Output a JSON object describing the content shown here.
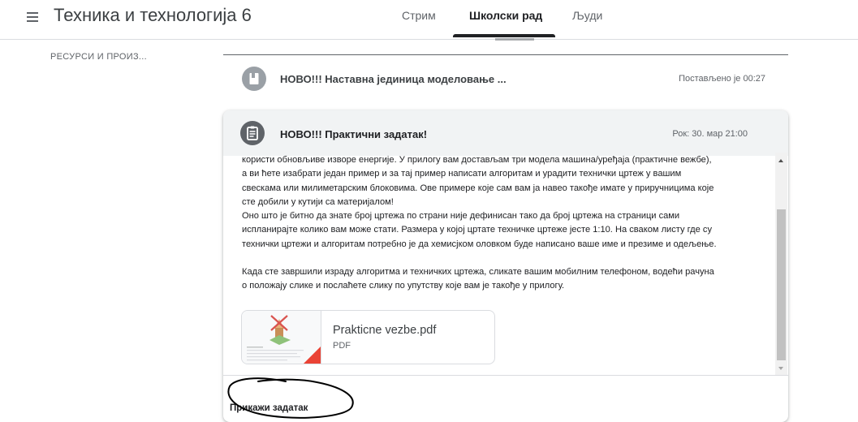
{
  "header": {
    "class_title": "Техника и технологија 6",
    "tabs": [
      {
        "label": "Стрим",
        "active": false
      },
      {
        "label": "Школски рад",
        "active": true
      },
      {
        "label": "Људи",
        "active": false
      }
    ]
  },
  "sidebar": {
    "topic_label": "РЕСУРСИ И ПРОИЗ..."
  },
  "material_item": {
    "icon": "bookmark-icon",
    "title": "НОВО!!! Наставна јединица моделовање ...",
    "meta": "Постављено је 00:27"
  },
  "assignment": {
    "icon": "assignment-icon",
    "title": "НОВО!!! Практични задатак!",
    "due": "Рок: 30. мар 21:00",
    "description": [
      "користи обновљиве изворе енергије. У прилогу вам достављам три модела машина/уређаја (практичне вежбе),",
      "а ви ћете изабрати један пример и за тај пример написати алгоритам и урадити технички цртеж у вашим",
      "свескама или милиметарским блоковима. Ове примере које сам вам ја навео такође имате у приручницима које",
      "сте добили у кутији са материјалом!",
      "Оно што је битно да знате број цртежа по страни није дефинисан тако да број цртежа на страници сами",
      "испланирајте колико вам може стати. Размера у којој цртате техничке цртеже јесте 1:10. На сваком листу где су",
      "технички цртежи и алгоритам потребно је да хемисјком оловком буде написано ваше име и презиме и одељење.",
      "",
      "Када сте завршили израду алгоритма и техничких цртежа, сликате вашим мобилним телефоном, водећи рачуна",
      "о положају слике и послаћете слику по упутству које вам је такође у прилогу."
    ],
    "attachment": {
      "name": "Prakticne vezbe.pdf",
      "type": "PDF",
      "icon": "pdf-thumbnail"
    },
    "view_label": "Прикажи задатак"
  },
  "colors": {
    "accent": "#202124",
    "header_bg": "#f1f3f4",
    "pdf_red": "#ea4335",
    "icon_grey": "#5f6368"
  }
}
